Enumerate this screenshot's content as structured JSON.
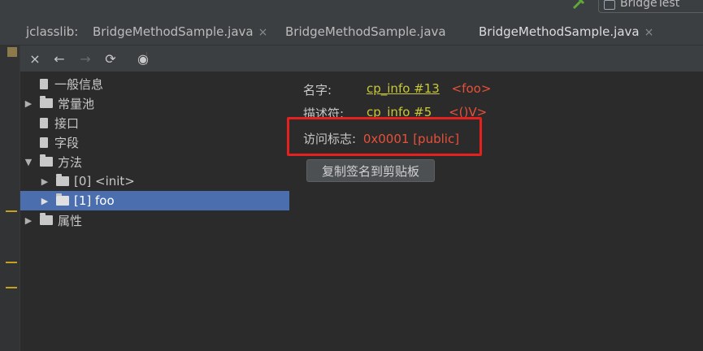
{
  "run_config": {
    "label": "BridgeTest"
  },
  "tabs": {
    "tool_title": "jclasslib:",
    "items": [
      {
        "label": "BridgeMethodSample.java",
        "active": false,
        "closable": true
      },
      {
        "label": "BridgeMethodSample.java",
        "active": false,
        "closable": false
      },
      {
        "label": "BridgeMethodSample.java",
        "active": true,
        "closable": true
      }
    ],
    "close_glyph": "×"
  },
  "toolbar": {
    "close_icon": "×",
    "back_icon": "←",
    "forward_icon": "→",
    "refresh_icon": "⟳",
    "web_icon": "◉"
  },
  "tree": {
    "nodes": [
      {
        "label": "一般信息",
        "kind": "file"
      },
      {
        "label": "常量池",
        "kind": "folder",
        "expanded": false
      },
      {
        "label": "接口",
        "kind": "file"
      },
      {
        "label": "字段",
        "kind": "file"
      },
      {
        "label": "方法",
        "kind": "folder",
        "expanded": true
      },
      {
        "label": "[0] <init>",
        "kind": "folder",
        "expanded": false
      },
      {
        "label": "[1] foo",
        "kind": "folder",
        "expanded": false,
        "selected": true
      },
      {
        "label": "属性",
        "kind": "folder",
        "expanded": false
      }
    ]
  },
  "detail": {
    "name_label": "名字:",
    "name_link": "cp_info #13",
    "name_value": "<foo>",
    "descriptor_label": "描述符:",
    "descriptor_link": "cp_info #5",
    "descriptor_value": "<()V>",
    "access_label": "访问标志:",
    "access_value": "0x0001 [public]",
    "copy_button": "复制签名到剪贴板"
  },
  "colors": {
    "accent": "#4a88c7",
    "selection": "#4b6eaf",
    "link": "#c8c83a",
    "value": "#e8503a",
    "highlight": "#e61f1f"
  }
}
